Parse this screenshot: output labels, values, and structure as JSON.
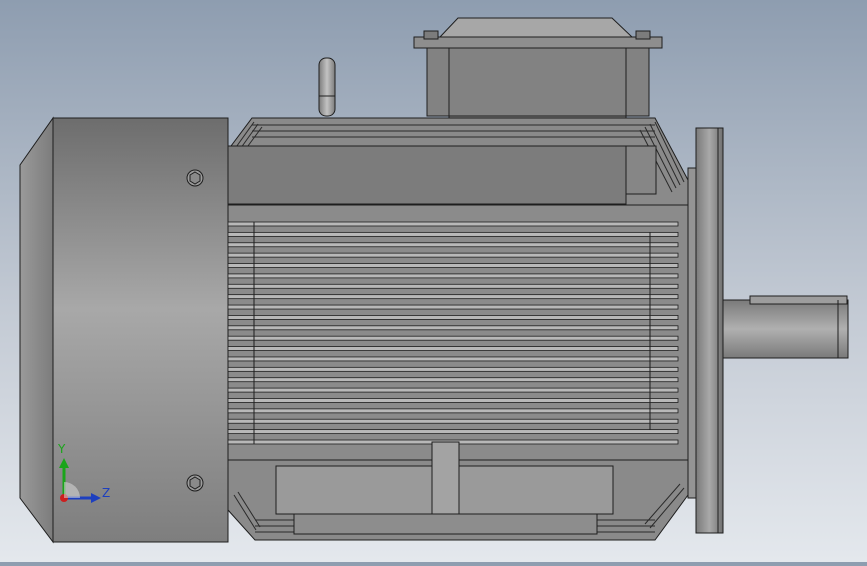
{
  "triad": {
    "y_label": "Y",
    "z_label": "Z",
    "colors": {
      "x": "#cc1f1f",
      "y": "#1aa51a",
      "z": "#1d3fbf"
    }
  },
  "model": {
    "colors": {
      "body": "#8f8f8f",
      "body_dark": "#6a6a6a",
      "edge": "#1e1e1e",
      "fin": "#b8b8b8",
      "fin_dark": "#5d5d5d"
    },
    "fin_count": 22
  }
}
